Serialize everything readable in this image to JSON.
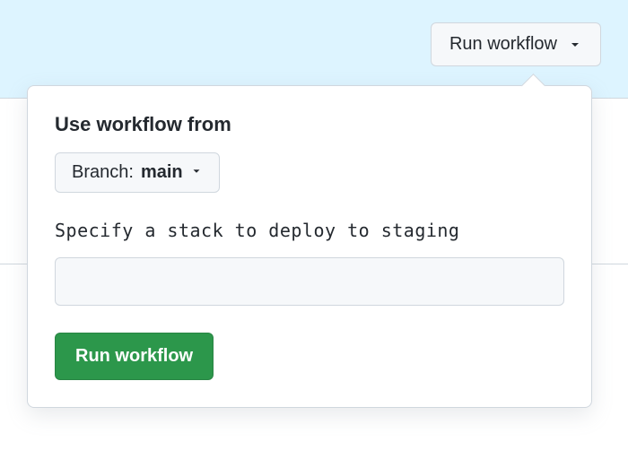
{
  "trigger": {
    "label": "Run workflow"
  },
  "panel": {
    "use_from_label": "Use workflow from",
    "branch_prefix": "Branch: ",
    "branch_name": "main",
    "stack_input_label": "Specify a stack to deploy to staging",
    "stack_input_value": "",
    "submit_label": "Run workflow"
  }
}
